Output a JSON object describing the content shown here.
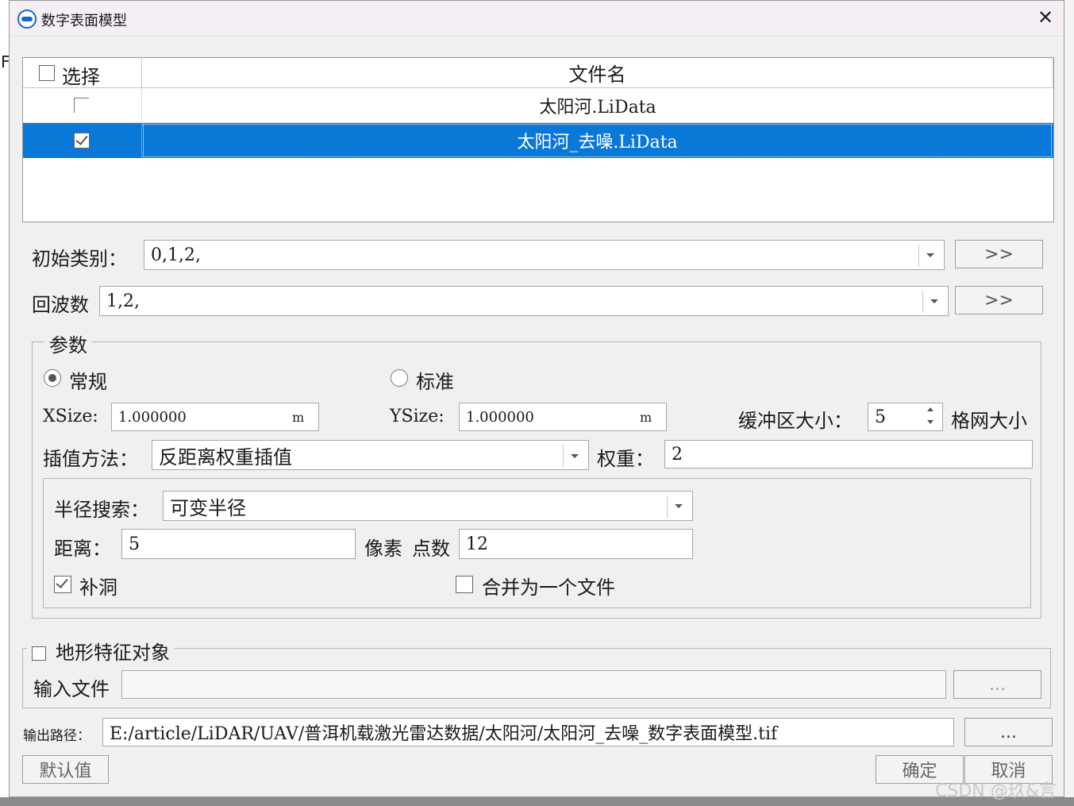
{
  "window": {
    "title": "数字表面模型",
    "close_glyph": "✕"
  },
  "file_table": {
    "headers": {
      "select": "选择",
      "filename": "文件名"
    },
    "rows": [
      {
        "filename": "太阳河.LiData",
        "checked": false,
        "selected": false
      },
      {
        "filename": "太阳河_去噪.LiData",
        "checked": true,
        "selected": true
      }
    ]
  },
  "initial_class": {
    "label": "初始类别：",
    "value": "0,1,2,",
    "more_button": ">>"
  },
  "returns": {
    "label": "回波数",
    "value": "1,2,",
    "more_button": ">>"
  },
  "params": {
    "group_title": "参数",
    "mode_normal": "常规",
    "mode_standard": "标准",
    "xsize_label": "XSize:",
    "xsize_value": "1.000000",
    "xsize_unit": "m",
    "ysize_label": "YSize:",
    "ysize_value": "1.000000",
    "ysize_unit": "m",
    "buffer_label": "缓冲区大小：",
    "buffer_value": "5",
    "grid_label": "格网大小",
    "interp_label": "插值方法：",
    "interp_value": "反距离权重插值",
    "weight_label": "权重：",
    "weight_value": "2",
    "radius": {
      "search_label": "半径搜索：",
      "search_value": "可变半径",
      "distance_label": "距离：",
      "distance_value": "5",
      "pixel_label": "像素",
      "points_label": "点数",
      "points_value": "12",
      "fill_holes_label": "补洞",
      "merge_label": "合并为一个文件"
    }
  },
  "terrain": {
    "group_title": "地形特征对象",
    "input_label": "输入文件",
    "input_value": "",
    "browse": "..."
  },
  "output": {
    "label": "输出路径：",
    "path": "E:/article/LiDAR/UAV/普洱机载激光雷达数据/太阳河/太阳河_去噪_数字表面模型.tif",
    "browse": "..."
  },
  "buttons": {
    "default": "默认值",
    "ok": "确定",
    "cancel": "取消"
  },
  "watermark": "CSDN @玖&言",
  "background": {
    "left_mark": "F"
  }
}
